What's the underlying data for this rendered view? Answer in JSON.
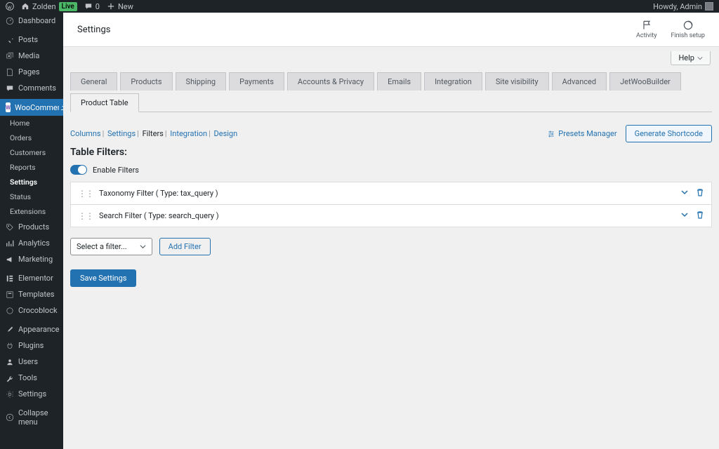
{
  "adminbar": {
    "site_name": "Zolden",
    "live_label": "Live",
    "comments_count": "0",
    "new_label": "New",
    "howdy": "Howdy, Admin"
  },
  "sidebar": {
    "items": [
      {
        "label": "Dashboard",
        "icon": "dashboard"
      },
      {
        "label": "Posts",
        "icon": "pin"
      },
      {
        "label": "Media",
        "icon": "media"
      },
      {
        "label": "Pages",
        "icon": "page"
      },
      {
        "label": "Comments",
        "icon": "comment"
      },
      {
        "label": "WooCommerce",
        "icon": "woo"
      },
      {
        "label": "Products",
        "icon": "tag"
      },
      {
        "label": "Analytics",
        "icon": "chart"
      },
      {
        "label": "Marketing",
        "icon": "megaphone"
      },
      {
        "label": "Elementor",
        "icon": "elementor"
      },
      {
        "label": "Templates",
        "icon": "templates"
      },
      {
        "label": "Crocoblock",
        "icon": "croco"
      },
      {
        "label": "Appearance",
        "icon": "brush"
      },
      {
        "label": "Plugins",
        "icon": "plug"
      },
      {
        "label": "Users",
        "icon": "user"
      },
      {
        "label": "Tools",
        "icon": "wrench"
      },
      {
        "label": "Settings",
        "icon": "gear"
      },
      {
        "label": "Collapse menu",
        "icon": "collapse"
      }
    ],
    "woo_sub": [
      "Home",
      "Orders",
      "Customers",
      "Reports",
      "Settings",
      "Status",
      "Extensions"
    ]
  },
  "topbar": {
    "title": "Settings",
    "activity": "Activity",
    "finish": "Finish setup",
    "help": "Help"
  },
  "tabs": [
    "General",
    "Products",
    "Shipping",
    "Payments",
    "Accounts & Privacy",
    "Emails",
    "Integration",
    "Site visibility",
    "Advanced",
    "JetWooBuilder",
    "Product Table"
  ],
  "crumbs": [
    "Columns",
    "Settings",
    "Filters",
    "Integration",
    "Design"
  ],
  "presets_label": "Presets Manager",
  "generate_label": "Generate Shortcode",
  "section_title": "Table Filters:",
  "enable_label": "Enable Filters",
  "filters": [
    "Taxonomy Filter ( Type: tax_query )",
    "Search Filter ( Type: search_query )"
  ],
  "select_placeholder": "Select a filter...",
  "add_filter": "Add Filter",
  "save": "Save Settings"
}
